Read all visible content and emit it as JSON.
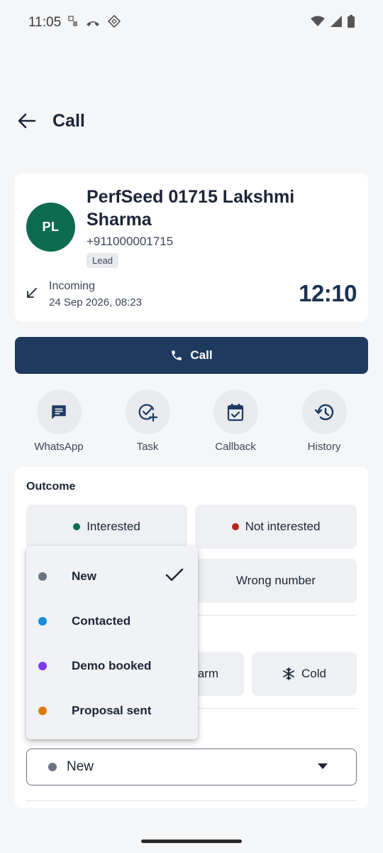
{
  "status_bar": {
    "time": "11:05"
  },
  "app_bar": {
    "title": "Call"
  },
  "contact": {
    "initials": "PL",
    "name": "PerfSeed 01715 Lakshmi Sharma",
    "phone": "+911000001715",
    "badge": "Lead",
    "direction": "Incoming",
    "datetime": "24 Sep 2026, 08:23",
    "duration": "12:10"
  },
  "call_button": {
    "label": "Call"
  },
  "actions": [
    {
      "label": "WhatsApp",
      "icon": "message-icon"
    },
    {
      "label": "Task",
      "icon": "task-add-icon"
    },
    {
      "label": "Callback",
      "icon": "calendar-check-icon"
    },
    {
      "label": "History",
      "icon": "history-icon"
    }
  ],
  "outcome": {
    "title": "Outcome",
    "chips": [
      {
        "label": "Interested",
        "color": "#0d6b4f"
      },
      {
        "label": "Not interested",
        "color": "#b3261e"
      },
      {
        "label": "Wrong number"
      }
    ],
    "temperature_chips": [
      {
        "label": "arm"
      },
      {
        "label": "Cold",
        "icon": "snowflake-icon"
      }
    ]
  },
  "status_select": {
    "value": "New",
    "color": "#6b7385"
  },
  "dropdown": {
    "items": [
      {
        "label": "New",
        "color": "#6b7385",
        "selected": true
      },
      {
        "label": "Contacted",
        "color": "#1a8bd6"
      },
      {
        "label": "Demo booked",
        "color": "#7c3aed"
      },
      {
        "label": "Proposal sent",
        "color": "#d97b0e"
      }
    ]
  },
  "colors": {
    "primary": "#1e3a5f",
    "avatar": "#0d6b4f"
  }
}
